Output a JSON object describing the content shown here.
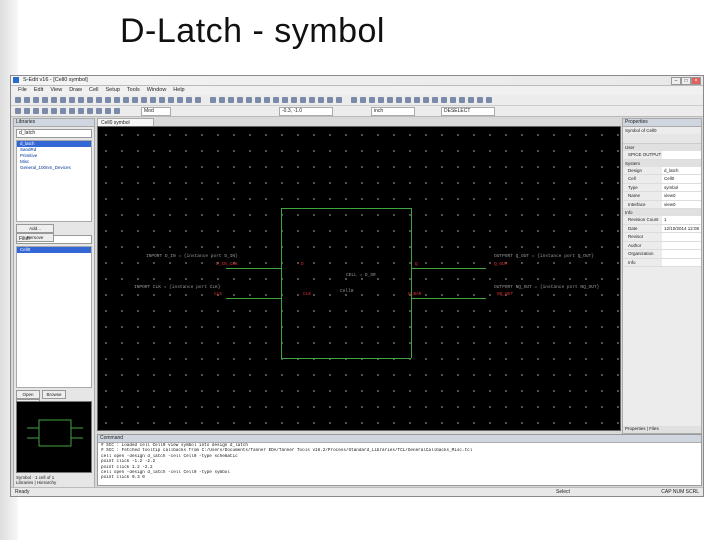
{
  "slide": {
    "title": "D-Latch  -  symbol"
  },
  "window": {
    "title": "S-Edit v16  - [Cell0 symbol]",
    "menu": [
      "File",
      "Edit",
      "View",
      "Draw",
      "Cell",
      "Setup",
      "Tools",
      "Window",
      "Help"
    ],
    "fields": {
      "mode": "Mod",
      "coords": "-0.3, -1.0",
      "unit": "inch",
      "cursor_mode": "DESELECT"
    },
    "tab": "Cell0 symbol"
  },
  "left_panel": {
    "header": "Libraries",
    "library_select": "d_latch",
    "libraries": [
      "d_latch",
      "SandRd",
      "Primitive",
      "Misc",
      "General_100nm_Devices"
    ],
    "buttons": [
      "Add...",
      "Remove"
    ],
    "filter_label": "Filter",
    "cells": [
      "Cell0"
    ],
    "bottom_buttons": [
      "Open",
      "Browse",
      "Find"
    ],
    "view_label": "Symbol",
    "view_count": "1 cell of 1",
    "bottom_tabs": [
      "Libraries",
      "Hierarchy"
    ]
  },
  "symbol": {
    "labels": [
      {
        "text": "D_IN_CLK",
        "cls": "red"
      },
      {
        "text": "D",
        "cls": "red"
      },
      {
        "text": "Q",
        "cls": "red"
      },
      {
        "text": "Q_OUT",
        "cls": "red"
      },
      {
        "text": "CELL = D_SR",
        "cls": "grey"
      },
      {
        "text": "Cell0",
        "cls": "grey"
      },
      {
        "text": "CLK",
        "cls": "red"
      },
      {
        "text": "CLK",
        "cls": "red"
      },
      {
        "text": "Q_BAR",
        "cls": "red"
      },
      {
        "text": "NQ_OUT",
        "cls": "red"
      },
      {
        "text": "INPORT D_IN = {instance port D_IN}",
        "cls": "grey"
      },
      {
        "text": "OUTPORT Q_OUT = {instance port Q_OUT}",
        "cls": "grey"
      },
      {
        "text": "INPORT CLK = {instance port CLK}",
        "cls": "grey"
      },
      {
        "text": "OUTPORT NQ_OUT = {instance port NQ_OUT}",
        "cls": "grey"
      }
    ]
  },
  "right_panel": {
    "header": "Properties",
    "object": "Symbol of Cell0",
    "groups": [
      {
        "name": "User",
        "rows": [
          {
            "k": "SPICE OUTPUT",
            "v": ""
          }
        ]
      },
      {
        "name": "System",
        "rows": [
          {
            "k": "Design",
            "v": "d_latch"
          },
          {
            "k": "Cell",
            "v": "Cell0"
          },
          {
            "k": "Type",
            "v": "symbol"
          },
          {
            "k": "Name",
            "v": "view0"
          },
          {
            "k": "Interface",
            "v": "view0"
          }
        ]
      },
      {
        "name": "Info",
        "rows": [
          {
            "k": "Revision Count",
            "v": "1"
          },
          {
            "k": "Date",
            "v": "12/10/2014 12:08"
          },
          {
            "k": "Revisor",
            "v": ""
          },
          {
            "k": "Author",
            "v": ""
          },
          {
            "k": "Organization",
            "v": ""
          },
          {
            "k": "Info",
            "v": ""
          }
        ]
      }
    ],
    "bottom_tabs": [
      "Properties",
      "Files"
    ]
  },
  "command": {
    "header": "Command",
    "lines": [
      "# SCC : Loaded cell Cell0 view symbol into design d_latch",
      "# SCC : Fetched tooltip callbacks from C:/Users/Documents/Tanner EDA/Tanner Tools v16.2/Process/Standard_Libraries/TCL/GeneralCallbacks_Misc.tcl",
      "cell open -design d_latch -cell Cell0 -type schematic",
      "point click -1.2 -2.2",
      "point click 1.2 -2.2",
      "cell open -design d_latch -cell Cell0 -type symbol",
      "point click 0.3 0"
    ]
  },
  "status": {
    "left": "Ready",
    "middle": "Select",
    "right": "CAP NUM SCRL"
  }
}
